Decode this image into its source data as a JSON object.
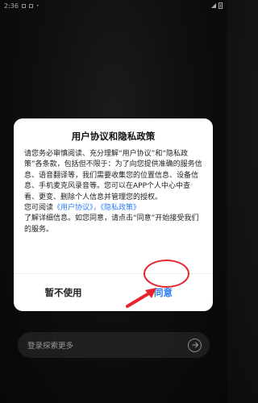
{
  "status_bar": {
    "time": "2:36"
  },
  "dialog": {
    "title": "用户协议和隐私政策",
    "para1": "请您务必审慎阅读、充分理解“用户协议”和“隐私政策”各条款，包括但不限于：为了向您提供准确的服务信息、语音翻译等，我们需要收集您的位置信息、设备信息、手机麦克风录音等。您可以在APP个人中心中查看、更变、删除个人信息并管理您的授权。",
    "para2_prefix": "您可阅读",
    "user_agreement_link": "《用户协议》",
    "separator": "，",
    "privacy_link": "《隐私政策》",
    "para2_suffix": "了解详细信息。如您同意，请点击“同意”开始接受我们的服务。",
    "decline_label": "暂不使用",
    "agree_label": "同意"
  },
  "search": {
    "placeholder": "登录探索更多"
  },
  "colors": {
    "accent": "#2b7cf6",
    "annotation": "#e8232e",
    "background": "#151515",
    "dialog_bg": "#ffffff"
  }
}
